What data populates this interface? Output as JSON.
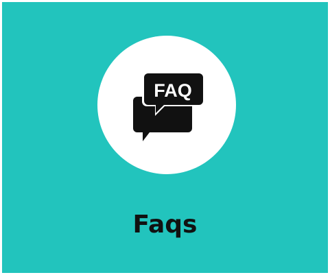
{
  "card": {
    "title": "Faqs",
    "icon": {
      "name": "faq-chat-bubbles-icon",
      "text": "FAQ"
    }
  },
  "colors": {
    "card_background": "#22c4bd",
    "circle_background": "#ffffff",
    "icon_color": "#111111",
    "title_color": "#111111"
  }
}
